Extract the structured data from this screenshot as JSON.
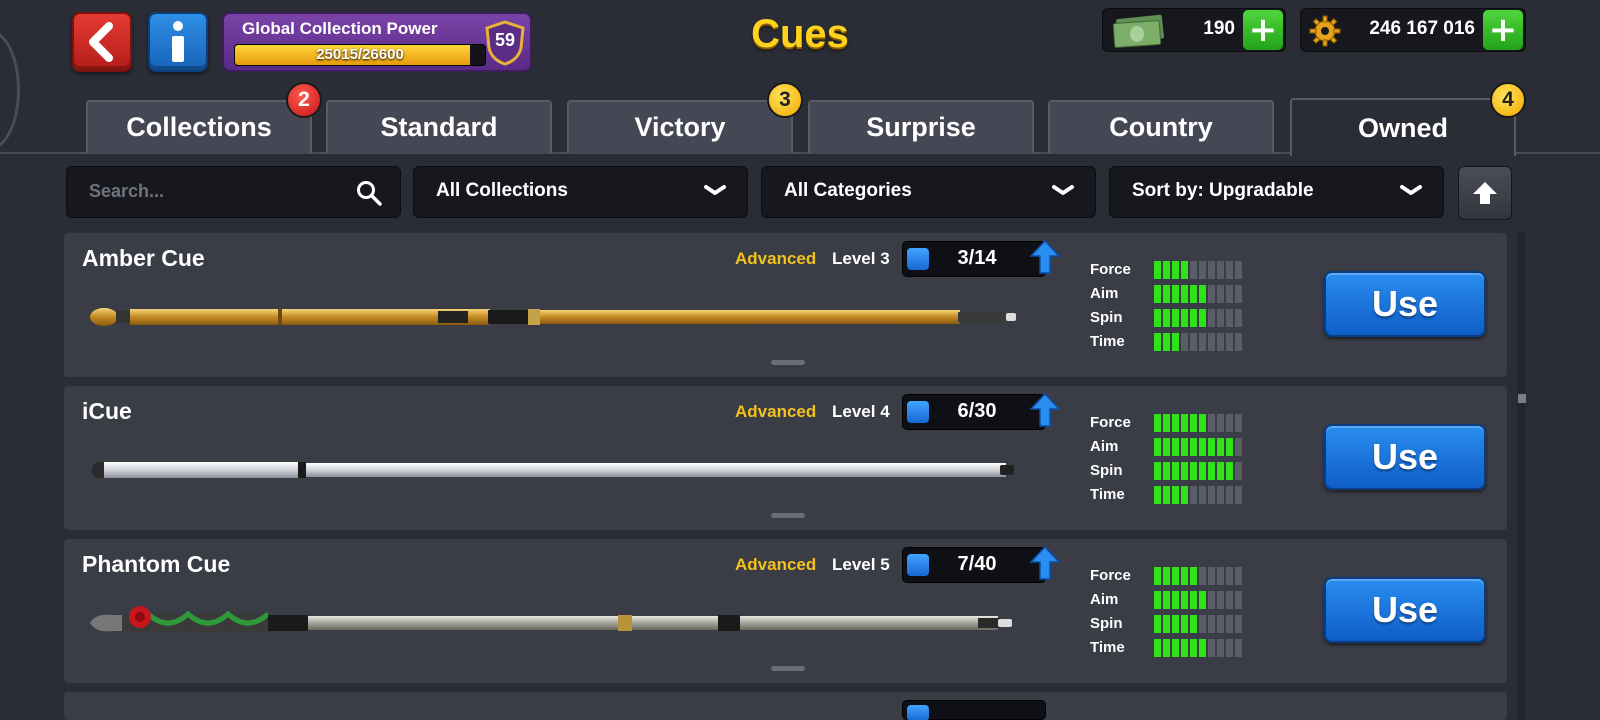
{
  "header": {
    "title": "Cues",
    "global_collection_power": {
      "label": "Global Collection Power",
      "progress_text": "25015/26600",
      "current": 25015,
      "max": 26600,
      "level": "59"
    },
    "cash": {
      "value": "190",
      "icon": "cash-icon"
    },
    "coins": {
      "value": "246 167 016",
      "icon": "coin-gear-icon"
    }
  },
  "tabs": [
    {
      "label": "Collections",
      "badge": "2",
      "badge_color": "#d41c1c"
    },
    {
      "label": "Standard",
      "badge": ""
    },
    {
      "label": "Victory",
      "badge": "3",
      "badge_color": "#f2b400"
    },
    {
      "label": "Surprise",
      "badge": ""
    },
    {
      "label": "Country",
      "badge": ""
    },
    {
      "label": "Owned",
      "badge": "4",
      "badge_color": "#f2b400",
      "active": true
    }
  ],
  "filters": {
    "search_placeholder": "Search...",
    "collections": "All Collections",
    "categories": "All Categories",
    "sort": "Sort by: Upgradable"
  },
  "stat_labels": [
    "Force",
    "Aim",
    "Spin",
    "Time"
  ],
  "cues": [
    {
      "name": "Amber Cue",
      "tier": "Advanced",
      "level": "Level 3",
      "progress": "3/14",
      "stats": [
        4,
        6,
        6,
        3
      ],
      "stat_max": 10,
      "use_label": "Use",
      "style": "gold"
    },
    {
      "name": "iCue",
      "tier": "Advanced",
      "level": "Level 4",
      "progress": "6/30",
      "stats": [
        6,
        9,
        9,
        4
      ],
      "stat_max": 10,
      "use_label": "Use",
      "style": "silver"
    },
    {
      "name": "Phantom Cue",
      "tier": "Advanced",
      "level": "Level 5",
      "progress": "7/40",
      "stats": [
        5,
        6,
        5,
        6
      ],
      "stat_max": 10,
      "use_label": "Use",
      "style": "phantom"
    }
  ],
  "colors": {
    "background": "#2b2d36",
    "row": "#3a3c46",
    "accent_yellow": "#ffd21e",
    "tier_gold": "#f2c21b",
    "stat_on": "#2fe31a",
    "use_blue": "#1a75e0"
  }
}
